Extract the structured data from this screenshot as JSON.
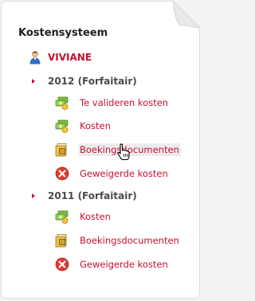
{
  "panel": {
    "title": "Kostensysteem",
    "user": {
      "name": "VIVIANE",
      "icon": "user-icon"
    },
    "years": [
      {
        "label": "2012 (Forfaitair)",
        "items": [
          {
            "label": "Te valideren kosten",
            "icon": "money-icon"
          },
          {
            "label": "Kosten",
            "icon": "money-icon"
          },
          {
            "label": "Boekingsdocumenten",
            "icon": "documents-icon",
            "hovered": true
          },
          {
            "label": "Geweigerde kosten",
            "icon": "rejected-icon"
          }
        ]
      },
      {
        "label": "2011 (Forfaitair)",
        "items": [
          {
            "label": "Kosten",
            "icon": "money-icon"
          },
          {
            "label": "Boekingsdocumenten",
            "icon": "documents-icon"
          },
          {
            "label": "Geweigerde kosten",
            "icon": "rejected-icon"
          }
        ]
      }
    ]
  },
  "colors": {
    "accent": "#c8102e",
    "heading": "#1f1f1f",
    "year": "#4a4a4a"
  }
}
